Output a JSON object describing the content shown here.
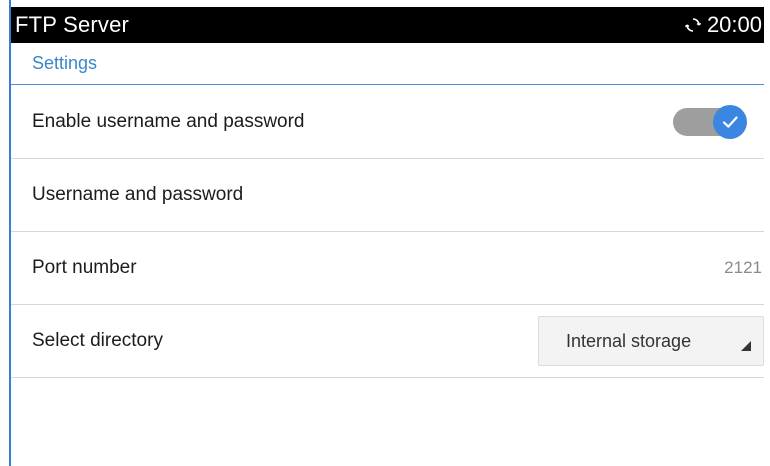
{
  "titlebar": {
    "title": "FTP Server",
    "time": "20:00",
    "status_icon": "sync-icon"
  },
  "section": {
    "title": "Settings"
  },
  "rows": [
    {
      "label": "Enable username and password",
      "control": "toggle",
      "checked": true,
      "icon": "check-icon"
    },
    {
      "label": "Username and password"
    },
    {
      "label": "Port number",
      "value": "2121"
    },
    {
      "label": "Select directory",
      "dropdown": "Internal storage",
      "icon": "dropdown-arrow-icon"
    }
  ],
  "colors": {
    "accent": "#3b86e0",
    "title_bar": "#000000",
    "section_title": "#3a87c8",
    "toggle_track": "#9e9e9e"
  }
}
